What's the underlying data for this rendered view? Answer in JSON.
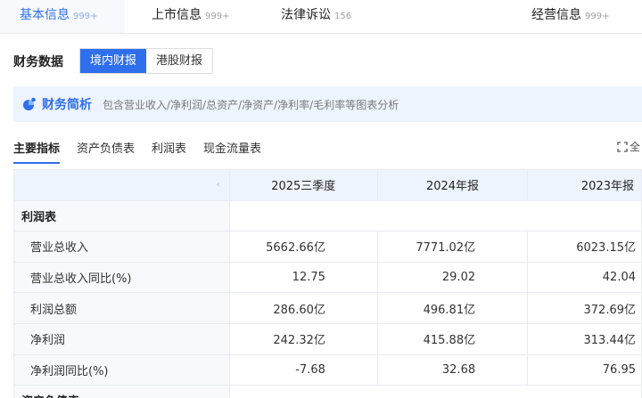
{
  "top_tabs": [
    {
      "label": "基本信息",
      "count": "999+"
    },
    {
      "label": "上市信息",
      "count": "999+"
    },
    {
      "label": "法律诉讼",
      "count": "156"
    },
    {
      "label": "经营信息",
      "count": "999+"
    }
  ],
  "finance": {
    "label": "财务数据",
    "toggle": [
      "境内财报",
      "港股财报"
    ]
  },
  "banner": {
    "title": "财务简析",
    "desc": "包含营业收入/净利润/总资产/净资产/净利率/毛利率等图表分析"
  },
  "sub_tabs": [
    "主要指标",
    "资产负债表",
    "利润表",
    "现金流量表"
  ],
  "expand_label": "全",
  "table": {
    "corner_icon": "‹",
    "columns": [
      "2025三季度",
      "2024年报",
      "2023年报"
    ],
    "section": "利润表",
    "rows": [
      {
        "label": "营业总收入",
        "values": [
          "5662.66亿",
          "7771.02亿",
          "6023.15亿"
        ]
      },
      {
        "label": "营业总收入同比(%)",
        "values": [
          "12.75",
          "29.02",
          "42.04"
        ]
      },
      {
        "label": "利润总额",
        "values": [
          "286.60亿",
          "496.81亿",
          "372.69亿"
        ]
      },
      {
        "label": "净利润",
        "values": [
          "242.32亿",
          "415.88亿",
          "313.44亿"
        ]
      },
      {
        "label": "净利润同比(%)",
        "values": [
          "-7.68",
          "32.68",
          "76.95"
        ]
      }
    ],
    "next_section": "资产负债表"
  },
  "colors": {
    "accent": "#2f6fec",
    "banner_bg": "#eef4fd"
  }
}
